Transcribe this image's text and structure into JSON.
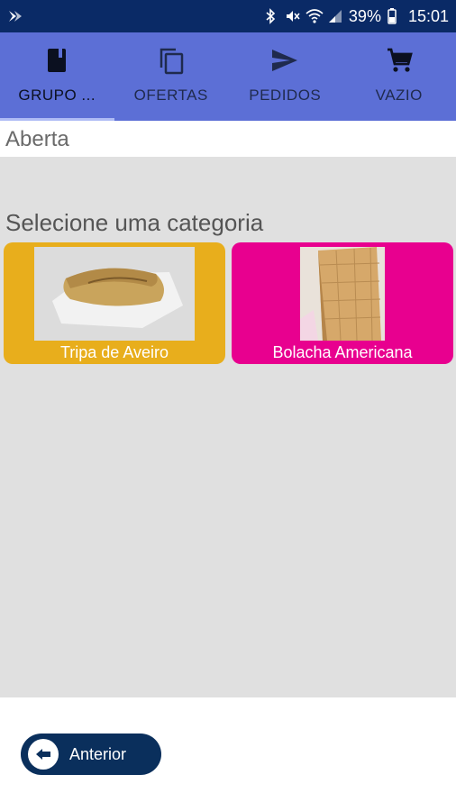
{
  "status_bar": {
    "battery": "39%",
    "time": "15:01",
    "icons": [
      "app-logo-icon",
      "bluetooth-icon",
      "mute-icon",
      "wifi-icon",
      "signal-icon",
      "battery-icon"
    ]
  },
  "tabs": [
    {
      "label": "GRUPO ...",
      "icon": "book-icon",
      "active": true
    },
    {
      "label": "OFERTAS",
      "icon": "copy-icon",
      "active": false
    },
    {
      "label": "PEDIDOS",
      "icon": "send-icon",
      "active": false
    },
    {
      "label": "VAZIO",
      "icon": "cart-icon",
      "active": false
    }
  ],
  "state_text": "Aberta",
  "section_title": "Selecione uma categoria",
  "categories": [
    {
      "label": "Tripa de Aveiro",
      "color": "#e8ae1c",
      "image": "pastry-image"
    },
    {
      "label": "Bolacha Americana",
      "color": "#e8008f",
      "image": "wafer-image"
    }
  ],
  "bottom": {
    "back_label": "Anterior"
  },
  "colors": {
    "status_bar": "#0a2a66",
    "tab_bar": "#5c6fd6",
    "main_bg": "#e0e0e0",
    "back_button": "#0a2f5c"
  }
}
